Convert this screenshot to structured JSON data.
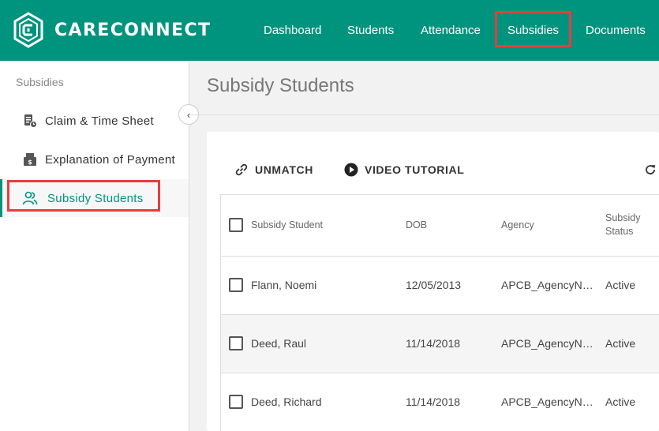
{
  "header": {
    "brand": "CARECONNECT",
    "nav": [
      "Dashboard",
      "Students",
      "Attendance",
      "Subsidies",
      "Documents"
    ],
    "active_nav": "Subsidies",
    "accent": "#00937e",
    "highlight": "#e53e3e"
  },
  "sidebar": {
    "section_title": "Subsidies",
    "items": [
      {
        "label": "Claim & Time Sheet",
        "icon": "clipboard-clock-icon"
      },
      {
        "label": "Explanation of Payment",
        "icon": "cash-register-icon"
      },
      {
        "label": "Subsidy Students",
        "icon": "people-icon"
      }
    ],
    "active_item": "Subsidy Students",
    "collapse_glyph": "‹"
  },
  "main": {
    "title": "Subsidy Students",
    "toolbar": {
      "unmatch_label": "UNMATCH",
      "video_label": "VIDEO TUTORIAL"
    },
    "table": {
      "headers": [
        "Subsidy Student",
        "DOB",
        "Agency",
        "Subsidy",
        "Status"
      ],
      "rows": [
        {
          "name": "Flann, Noemi",
          "dob": "12/05/2013",
          "agency": "APCB_AgencyN…",
          "status": "Active"
        },
        {
          "name": "Deed, Raul",
          "dob": "11/14/2018",
          "agency": "APCB_AgencyN…",
          "status": "Active"
        },
        {
          "name": "Deed, Richard",
          "dob": "11/14/2018",
          "agency": "APCB_AgencyN…",
          "status": "Active"
        }
      ]
    }
  }
}
